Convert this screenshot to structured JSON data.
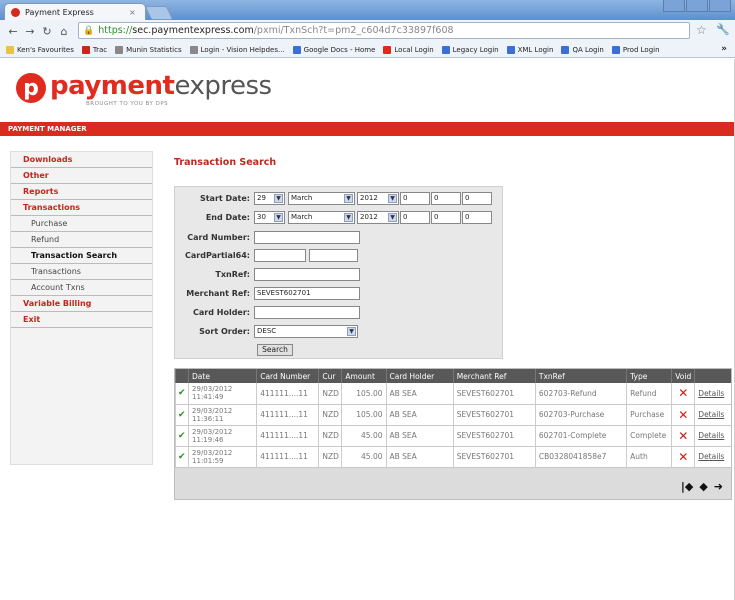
{
  "browser": {
    "tab_title": "Payment Express",
    "tab_close": "×",
    "url_scheme": "https://",
    "url_host": "sec.paymentexpress.com",
    "url_rest": "/pxmi/TxnSch?t=pm2_c604d7c33897f608",
    "bookmarks": [
      {
        "label": "Ken's Favourites",
        "color": "#e8c34a"
      },
      {
        "label": "Trac",
        "color": "#c8281c"
      },
      {
        "label": "Munin Statistics",
        "color": "#888888"
      },
      {
        "label": "Login - Vision Helpdes...",
        "color": "#888888"
      },
      {
        "label": "Google Docs - Home",
        "color": "#3a6fd8"
      },
      {
        "label": "Local Login",
        "color": "#d92c1e"
      },
      {
        "label": "Legacy Login",
        "color": "#3a6fd8"
      },
      {
        "label": "XML Login",
        "color": "#3a6fd8"
      },
      {
        "label": "QA Login",
        "color": "#3a6fd8"
      },
      {
        "label": "Prod Login",
        "color": "#3a6fd8"
      }
    ],
    "bookmarks_more": "»"
  },
  "logo": {
    "mark": "p",
    "word1": "payment",
    "word2": "express",
    "tagline": "BROUGHT TO YOU BY DPS"
  },
  "red_bar": "PAYMENT MANAGER",
  "sidebar": {
    "items": [
      {
        "label": "Downloads",
        "level": "top"
      },
      {
        "label": "Other",
        "level": "top"
      },
      {
        "label": "Reports",
        "level": "top"
      },
      {
        "label": "Transactions",
        "level": "top"
      },
      {
        "label": "Purchase",
        "level": "sub"
      },
      {
        "label": "Refund",
        "level": "sub"
      },
      {
        "label": "Transaction Search",
        "level": "sub-active"
      },
      {
        "label": "Transactions",
        "level": "sub"
      },
      {
        "label": "Account Txns",
        "level": "sub"
      },
      {
        "label": "Variable Billing",
        "level": "top"
      },
      {
        "label": "Exit",
        "level": "top"
      }
    ]
  },
  "main": {
    "title": "Transaction Search"
  },
  "form": {
    "start_date_label": "Start Date:",
    "start_day": "29",
    "start_month": "March",
    "start_year": "2012",
    "start_h": "0",
    "start_m": "0",
    "start_s": "0",
    "end_date_label": "End Date:",
    "end_day": "30",
    "end_month": "March",
    "end_year": "2012",
    "end_h": "0",
    "end_m": "0",
    "end_s": "0",
    "card_number_label": "Card Number:",
    "card_number": "",
    "card_partial_label": "CardPartial64:",
    "card_partial_a": "",
    "card_partial_b": "",
    "txnref_label": "TxnRef:",
    "txnref": "",
    "merchant_ref_label": "Merchant Ref:",
    "merchant_ref": "SEVEST602701",
    "card_holder_label": "Card Holder:",
    "card_holder": "",
    "sort_order_label": "Sort Order:",
    "sort_order": "DESC",
    "search_label": "Search"
  },
  "results": {
    "headers": [
      "",
      "Date",
      "Card Number",
      "Cur",
      "Amount",
      "Card Holder",
      "Merchant Ref",
      "TxnRef",
      "Type",
      "Void",
      ""
    ],
    "rows": [
      {
        "ok": "✔",
        "date1": "29/03/2012",
        "date2": "11:41:49",
        "card": "411111....11",
        "cur": "NZD",
        "amount": "105.00",
        "holder": "AB SEA",
        "merchant_ref": "SEVEST602701",
        "txnref": "602703-Refund",
        "type": "Refund",
        "void": "✕",
        "details": "Details"
      },
      {
        "ok": "✔",
        "date1": "29/03/2012",
        "date2": "11:36:11",
        "card": "411111....11",
        "cur": "NZD",
        "amount": "105.00",
        "holder": "AB SEA",
        "merchant_ref": "SEVEST602701",
        "txnref": "602703-Purchase",
        "type": "Purchase",
        "void": "✕",
        "details": "Details"
      },
      {
        "ok": "✔",
        "date1": "29/03/2012",
        "date2": "11:19:46",
        "card": "411111....11",
        "cur": "NZD",
        "amount": "45.00",
        "holder": "AB SEA",
        "merchant_ref": "SEVEST602701",
        "txnref": "602701-Complete",
        "type": "Complete",
        "void": "✕",
        "details": "Details"
      },
      {
        "ok": "✔",
        "date1": "29/03/2012",
        "date2": "11:01:59",
        "card": "411111....11",
        "cur": "NZD",
        "amount": "45.00",
        "holder": "AB SEA",
        "merchant_ref": "SEVEST602701",
        "txnref": "CB0328041858e7",
        "type": "Auth",
        "void": "✕",
        "details": "Details"
      }
    ],
    "pager": {
      "first": "|◆",
      "prev": "◆",
      "next": "➜"
    }
  }
}
